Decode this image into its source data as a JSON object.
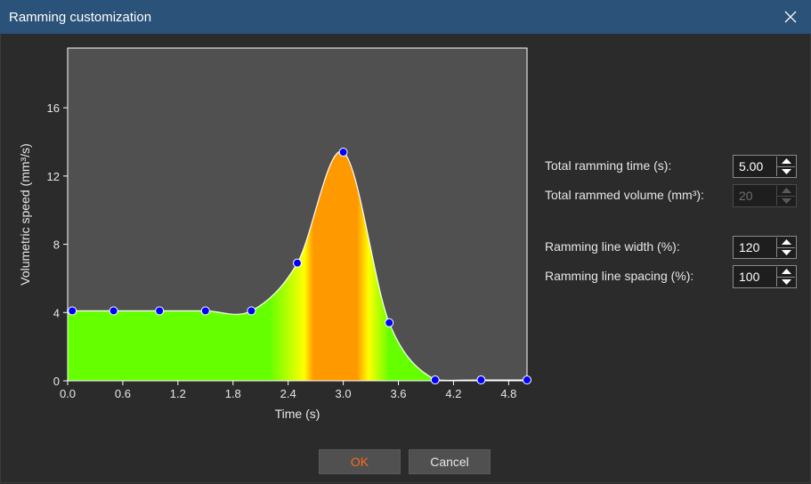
{
  "window": {
    "title": "Ramming customization",
    "close_icon": "close-icon"
  },
  "chart_data": {
    "type": "area",
    "xlabel": "Time (s)",
    "ylabel": "Volumetric speed (mm³/s)",
    "xlim": [
      0,
      5.0
    ],
    "ylim": [
      0,
      19.5
    ],
    "x_ticks": [
      "0.0",
      "0.6",
      "1.2",
      "1.8",
      "2.4",
      "3.0",
      "3.6",
      "4.2",
      "4.8"
    ],
    "y_ticks": [
      "0",
      "4",
      "8",
      "12",
      "16"
    ],
    "points": [
      {
        "x": 0.05,
        "y": 4.1
      },
      {
        "x": 0.5,
        "y": 4.1
      },
      {
        "x": 1.0,
        "y": 4.1
      },
      {
        "x": 1.5,
        "y": 4.1
      },
      {
        "x": 2.0,
        "y": 4.1
      },
      {
        "x": 2.5,
        "y": 6.9
      },
      {
        "x": 3.0,
        "y": 13.4
      },
      {
        "x": 3.5,
        "y": 3.4
      },
      {
        "x": 4.0,
        "y": 0.05
      },
      {
        "x": 4.5,
        "y": 0.05
      },
      {
        "x": 5.0,
        "y": 0.05
      }
    ],
    "colors": {
      "plot_bg": "#505050",
      "fill_low": "#66ff00",
      "fill_mid": "#ffff00",
      "fill_high": "#ff9900",
      "points": "#0000ff"
    }
  },
  "settings": {
    "ramming_time_label": "Total ramming time (s):",
    "ramming_time_value": "5.00",
    "rammed_volume_label": "Total rammed volume (mm³):",
    "rammed_volume_value": "20",
    "line_width_label": "Ramming line width (%):",
    "line_width_value": "120",
    "line_spacing_label": "Ramming line spacing (%):",
    "line_spacing_value": "100"
  },
  "buttons": {
    "ok": "OK",
    "cancel": "Cancel"
  }
}
